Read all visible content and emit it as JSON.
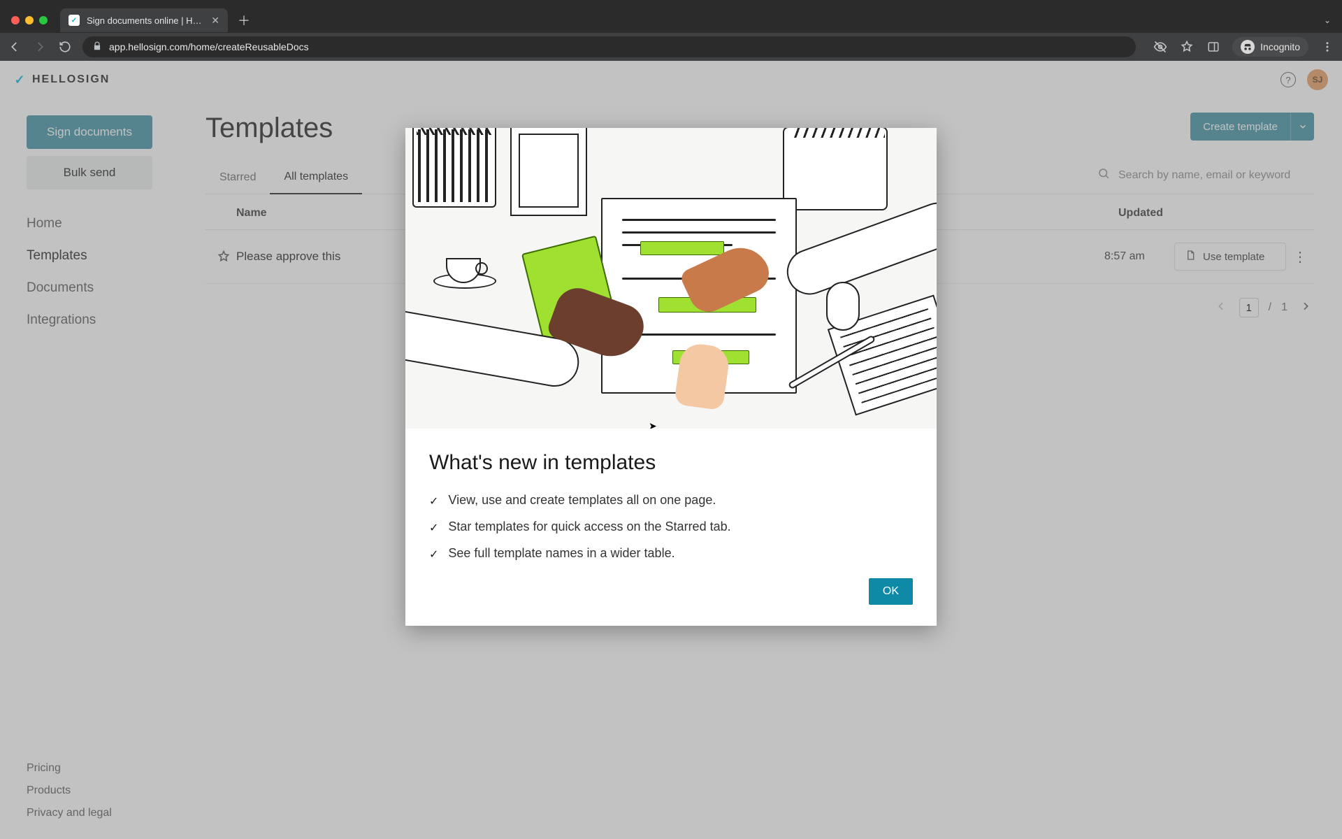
{
  "browser": {
    "tab_title": "Sign documents online | HelloS",
    "url": "app.hellosign.com/home/createReusableDocs",
    "incognito_label": "Incognito"
  },
  "header": {
    "brand": "HELLOSIGN",
    "avatar_initials": "SJ"
  },
  "sidebar": {
    "primary_btn": "Sign documents",
    "secondary_btn": "Bulk send",
    "nav": {
      "home": "Home",
      "templates": "Templates",
      "documents": "Documents",
      "integrations": "Integrations"
    },
    "footer": {
      "pricing": "Pricing",
      "products": "Products",
      "privacy": "Privacy and legal"
    }
  },
  "main": {
    "title": "Templates",
    "create_btn": "Create template",
    "tabs": {
      "starred": "Starred",
      "all": "All templates"
    },
    "search_placeholder": "Search by name, email or keyword",
    "columns": {
      "name": "Name",
      "updated": "Updated"
    },
    "rows": [
      {
        "name": "Please approve this",
        "updated": "8:57 am",
        "use_label": "Use template"
      }
    ],
    "pagination": {
      "current": "1",
      "sep": "/",
      "total": "1"
    }
  },
  "modal": {
    "title": "What's new in templates",
    "features": [
      "View, use and create templates all on one page.",
      "Star templates for quick access on the Starred tab.",
      "See full template names in a wider table."
    ],
    "ok": "OK"
  }
}
